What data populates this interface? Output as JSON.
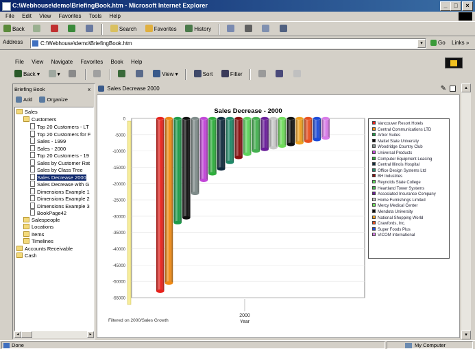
{
  "ie": {
    "title": "C:\\Webhouse\\demo\\BriefingBook.htm - Microsoft Internet Explorer",
    "menu": [
      "File",
      "Edit",
      "View",
      "Favorites",
      "Tools",
      "Help"
    ],
    "toolbar": {
      "back": "Back",
      "search": "Search",
      "favorites": "Favorites",
      "history": "History"
    },
    "address_label": "Address",
    "address_value": "C:\\Webhouse\\demo\\BriefingBook.htm",
    "go_label": "Go",
    "links_label": "Links"
  },
  "app": {
    "menu": [
      "File",
      "View",
      "Navigate",
      "Favorites",
      "Book",
      "Help"
    ],
    "toolbar": {
      "back": "Back",
      "view": "View",
      "sort": "Sort",
      "filter": "Filter"
    }
  },
  "sidebar": {
    "title": "Briefing Book",
    "close": "x",
    "add": "Add",
    "organize": "Organize",
    "items": [
      {
        "label": "Sales",
        "type": "folder",
        "level": 0
      },
      {
        "label": "Customers",
        "type": "folder",
        "level": 1
      },
      {
        "label": "Top 20 Customers - LT",
        "type": "page",
        "level": 2
      },
      {
        "label": "Top 20 Customers for F",
        "type": "page",
        "level": 2
      },
      {
        "label": "Sales - 1999",
        "type": "page",
        "level": 2
      },
      {
        "label": "Sales - 2000",
        "type": "page",
        "level": 2
      },
      {
        "label": "Top 20 Customers - 19",
        "type": "page",
        "level": 2
      },
      {
        "label": "Sales by Customer Rat",
        "type": "page",
        "level": 2
      },
      {
        "label": "Sales by Class Tree",
        "type": "page",
        "level": 2
      },
      {
        "label": "Sales Decrease 2000",
        "type": "page",
        "level": 2,
        "selected": true
      },
      {
        "label": "Sales Decrease with G",
        "type": "page",
        "level": 2
      },
      {
        "label": "Dimensions Example 1",
        "type": "page",
        "level": 2
      },
      {
        "label": "Dimensions Example 2",
        "type": "page",
        "level": 2
      },
      {
        "label": "Dimensions Example 3",
        "type": "page",
        "level": 2
      },
      {
        "label": "BookPage42",
        "type": "page",
        "level": 2
      },
      {
        "label": "Salespeople",
        "type": "folder",
        "level": 1
      },
      {
        "label": "Locations",
        "type": "folder",
        "level": 1
      },
      {
        "label": "Items",
        "type": "folder",
        "level": 1
      },
      {
        "label": "Timelines",
        "type": "folder",
        "level": 1
      },
      {
        "label": "Accounts Receivable",
        "type": "folder",
        "level": 0
      },
      {
        "label": "Cash",
        "type": "folder",
        "level": 0
      }
    ]
  },
  "report": {
    "tab_title": "Sales Decrease 2000",
    "footer_note": "Filtered on 2000/Sales Growth"
  },
  "chart_data": {
    "type": "bar",
    "title": "Sales Decrease - 2000",
    "xlabel": "Year",
    "ylabel": "",
    "categories": [
      "2000"
    ],
    "ylim": [
      -55000,
      0
    ],
    "yticks": [
      0,
      -5000,
      -10000,
      -15000,
      -20000,
      -25000,
      -30000,
      -35000,
      -40000,
      -45000,
      -50000,
      -55000
    ],
    "legend_position": "right",
    "series": [
      {
        "name": "Vancouver Resort Hotels",
        "value": -53000,
        "color": "#e8221c"
      },
      {
        "name": "Central Communications LTD",
        "value": -50500,
        "color": "#f08a14"
      },
      {
        "name": "Arbor Suites",
        "value": -32000,
        "color": "#1e9c4a"
      },
      {
        "name": "Mattel State University",
        "value": -30500,
        "color": "#101010"
      },
      {
        "name": "Woodridge Country Club",
        "value": -23000,
        "color": "#7f8c8a"
      },
      {
        "name": "Universal Products",
        "value": -19000,
        "color": "#c246d8"
      },
      {
        "name": "Computer Equipment Leasing",
        "value": -17000,
        "color": "#2fae3c"
      },
      {
        "name": "Central Illinois Hospital",
        "value": -15500,
        "color": "#0f2a3c"
      },
      {
        "name": "Office Design Systems Ltd",
        "value": -13500,
        "color": "#1f8a68"
      },
      {
        "name": "BH Industries",
        "value": -12000,
        "color": "#8a1010"
      },
      {
        "name": "Reynolds State College",
        "value": -11000,
        "color": "#5cd45c"
      },
      {
        "name": "Heartland Tower Systems",
        "value": -10000,
        "color": "#44b050"
      },
      {
        "name": "Associated Insurance Company",
        "value": -9500,
        "color": "#6a1d9a"
      },
      {
        "name": "Home Furnishings Limited",
        "value": -9000,
        "color": "#c8c8c8"
      },
      {
        "name": "Mercy Medical Center",
        "value": -8500,
        "color": "#6fdc5a"
      },
      {
        "name": "Mendota University",
        "value": -8000,
        "color": "#111111"
      },
      {
        "name": "National Shopping World",
        "value": -7500,
        "color": "#f0a020"
      },
      {
        "name": "Crawfords, Inc.",
        "value": -7000,
        "color": "#e85020"
      },
      {
        "name": "Super Foods Plus",
        "value": -6500,
        "color": "#1c4ad8"
      },
      {
        "name": "VICOM International",
        "value": -6000,
        "color": "#d87ae8"
      }
    ]
  },
  "statusbar": {
    "left": "Done",
    "zone": "My Computer"
  }
}
